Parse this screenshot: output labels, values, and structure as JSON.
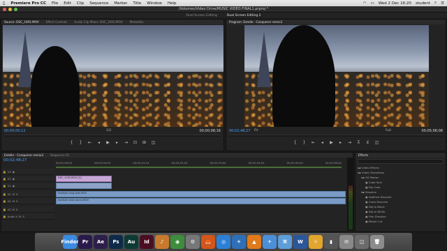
{
  "menubar": {
    "app": "Premiere Pro CC",
    "items": [
      "File",
      "Edit",
      "Clip",
      "Sequence",
      "Marker",
      "Title",
      "Window",
      "Help"
    ],
    "clock": "Wed 2 Dec  16:20",
    "user": "student"
  },
  "window": {
    "path": "/Volumes/Video Drive/MUSIC VIDEO FINAL1.prproj *",
    "workspace_tabs": [
      "Dual Screen Editing",
      "Dual Screen Editing 2"
    ]
  },
  "source": {
    "tabs": [
      "Source: DSC_1093.MOV",
      "Effect Controls",
      "Audio Clip Mixer: DSC_1093.MOV",
      "Metadata"
    ],
    "timecode_in": "00;00;00;12",
    "zoom": "1/2",
    "timecode_out": "00;00;08;16"
  },
  "program": {
    "tab": "Program: Estelle - Conqueror remix3",
    "timecode": "00;02;48;27",
    "fit": "Fit",
    "quality": "Full",
    "duration": "00;05;06;08"
  },
  "timeline": {
    "tabs": [
      "Estelle - Conqueror remix3",
      "Sequence 01"
    ],
    "timecode": "00;02;48;27",
    "ruler": [
      "00;02;49;04",
      "00;02;50;04",
      "00;02;51;04",
      "00;02;52;04",
      "00;02;53;04",
      "00;02;54;04",
      "00;02;55;04",
      "00;02;56;04"
    ],
    "tracks": [
      {
        "id": "V3",
        "clip": ""
      },
      {
        "id": "V2",
        "clip": "DSC_1093.MOV [V]"
      },
      {
        "id": "V1",
        "clip": ""
      },
      {
        "id": "A1",
        "clip": "medium long shot.MOV"
      },
      {
        "id": "A2",
        "clip": "medium shot canon.MOV"
      },
      {
        "id": "A3",
        "clip": ""
      },
      {
        "id": "Audio 4",
        "clip": ""
      }
    ]
  },
  "effects": {
    "title": "Effects",
    "items": [
      "Video Effects",
      "Video Transitions",
      "3D Motion",
      "Cube Spin",
      "Flip Over",
      "Dissolve",
      "Additive Dissolve",
      "Cross Dissolve",
      "Dip to Black",
      "Dip to White",
      "Film Dissolve",
      "Morph Cut"
    ]
  },
  "dock": [
    {
      "label": "Finder",
      "color": "#3b8be3"
    },
    {
      "label": "Pr",
      "color": "#2a1a4a"
    },
    {
      "label": "Ae",
      "color": "#2c1f4a"
    },
    {
      "label": "Ps",
      "color": "#0e2a48"
    },
    {
      "label": "Au",
      "color": "#0d3a35"
    },
    {
      "label": "Id",
      "color": "#4a0e22"
    },
    {
      "label": "♪",
      "color": "#c77a2e"
    },
    {
      "label": "◉",
      "color": "#3d8d3d"
    },
    {
      "label": "⚙",
      "color": "#777777"
    },
    {
      "label": "🦊",
      "color": "#d4551c"
    },
    {
      "label": "◎",
      "color": "#2c7fd6"
    },
    {
      "label": "☀",
      "color": "#2e6fb8"
    },
    {
      "label": "▲",
      "color": "#e07a1a"
    },
    {
      "label": "✈",
      "color": "#4b8fd8"
    },
    {
      "label": "⌘",
      "color": "#5e9dd9"
    },
    {
      "label": "W",
      "color": "#2b579a"
    },
    {
      "label": "☼",
      "color": "#e2a52e"
    },
    {
      "label": "▮",
      "color": "#555555"
    },
    {
      "label": "✉",
      "color": "#888888"
    },
    {
      "label": "◫",
      "color": "#6b6b6b"
    },
    {
      "label": "🗑",
      "color": "#8c8c8c"
    }
  ]
}
